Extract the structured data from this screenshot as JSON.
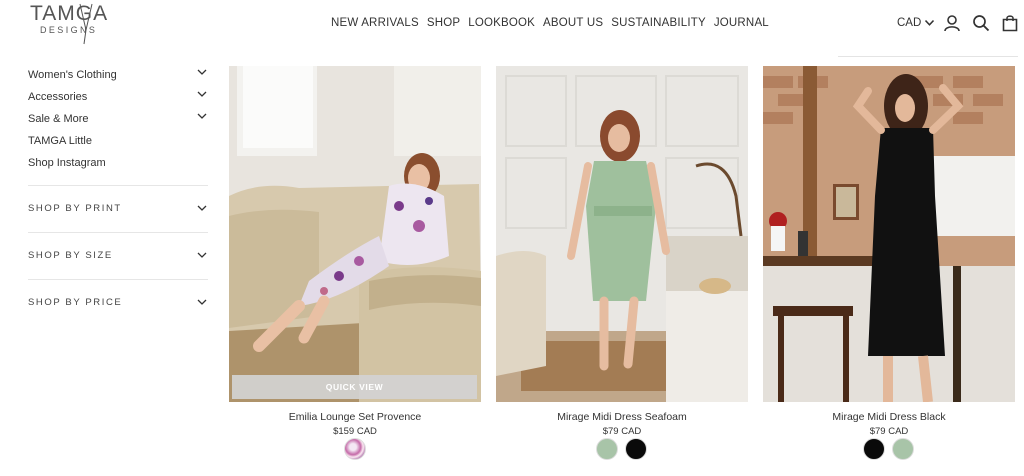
{
  "header": {
    "logo_top": "TAMGA",
    "logo_bottom": "DESIGNS",
    "nav": [
      "NEW ARRIVALS",
      "SHOP",
      "LOOKBOOK",
      "ABOUT US",
      "SUSTAINABILITY",
      "JOURNAL"
    ],
    "currency": "CAD",
    "icons": [
      "user-icon",
      "search-icon",
      "bag-icon"
    ]
  },
  "sidebar": {
    "links": [
      {
        "label": "Women's Clothing",
        "expandable": true
      },
      {
        "label": "Accessories",
        "expandable": true
      },
      {
        "label": "Sale & More",
        "expandable": true
      },
      {
        "label": "TAMGA Little",
        "expandable": false
      },
      {
        "label": "Shop Instagram",
        "expandable": false
      }
    ],
    "filters": [
      "SHOP BY PRINT",
      "SHOP BY SIZE",
      "SHOP BY PRICE"
    ]
  },
  "products": [
    {
      "name": "Emilia Lounge Set Provence",
      "price": "$159 CAD",
      "quick_view": "QUICK VIEW",
      "swatches": [
        "#c46aa8"
      ]
    },
    {
      "name": "Mirage Midi Dress Seafoam",
      "price": "$79 CAD",
      "swatches": [
        "#a8c4a8",
        "#0a0a0a"
      ]
    },
    {
      "name": "Mirage Midi Dress Black",
      "price": "$79 CAD",
      "swatches": [
        "#0a0a0a",
        "#a8c4a8"
      ]
    }
  ]
}
